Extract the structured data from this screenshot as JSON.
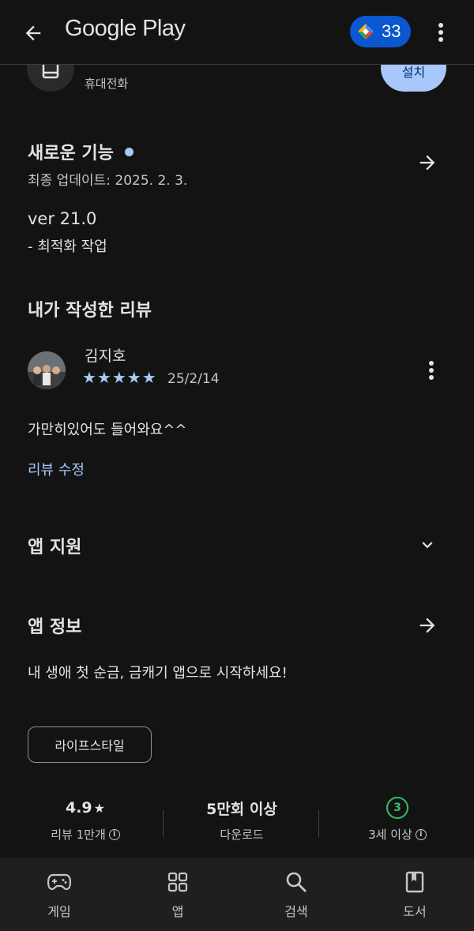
{
  "topbar": {
    "brand": "Google Play",
    "points": "33"
  },
  "app": {
    "subtitle": "휴대전화",
    "install_label": "설치"
  },
  "whats_new": {
    "title": "새로운 기능",
    "updated": "최종 업데이트: 2025. 2. 3.",
    "version": "ver 21.0",
    "notes": "- 최적화 작업"
  },
  "my_review": {
    "title": "내가 작성한 리뷰",
    "reviewer": "김지호",
    "stars": "★★★★★",
    "rating": 5,
    "date": "25/2/14",
    "text": "가만히있어도 들어와요^^",
    "edit_label": "리뷰 수정"
  },
  "support": {
    "title": "앱 지원"
  },
  "about": {
    "title": "앱 정보",
    "description": "내 생애 첫 순금, 금캐기 앱으로 시작하세요!",
    "tag": "라이프스타일"
  },
  "stats": {
    "rating_value": "4.9",
    "rating_star": "★",
    "rating_label": "리뷰 1만개",
    "downloads_value": "5만회 이상",
    "downloads_label": "다운로드",
    "age_badge": "3",
    "age_label": "3세 이상"
  },
  "bottom_nav": {
    "games": "게임",
    "apps": "앱",
    "search": "검색",
    "books": "도서"
  },
  "colors": {
    "background": "#131314",
    "accent": "#a8c7fa",
    "points_bg": "#0b57d0",
    "age_badge": "#37be5f",
    "nav_bg": "#1f1f22"
  }
}
